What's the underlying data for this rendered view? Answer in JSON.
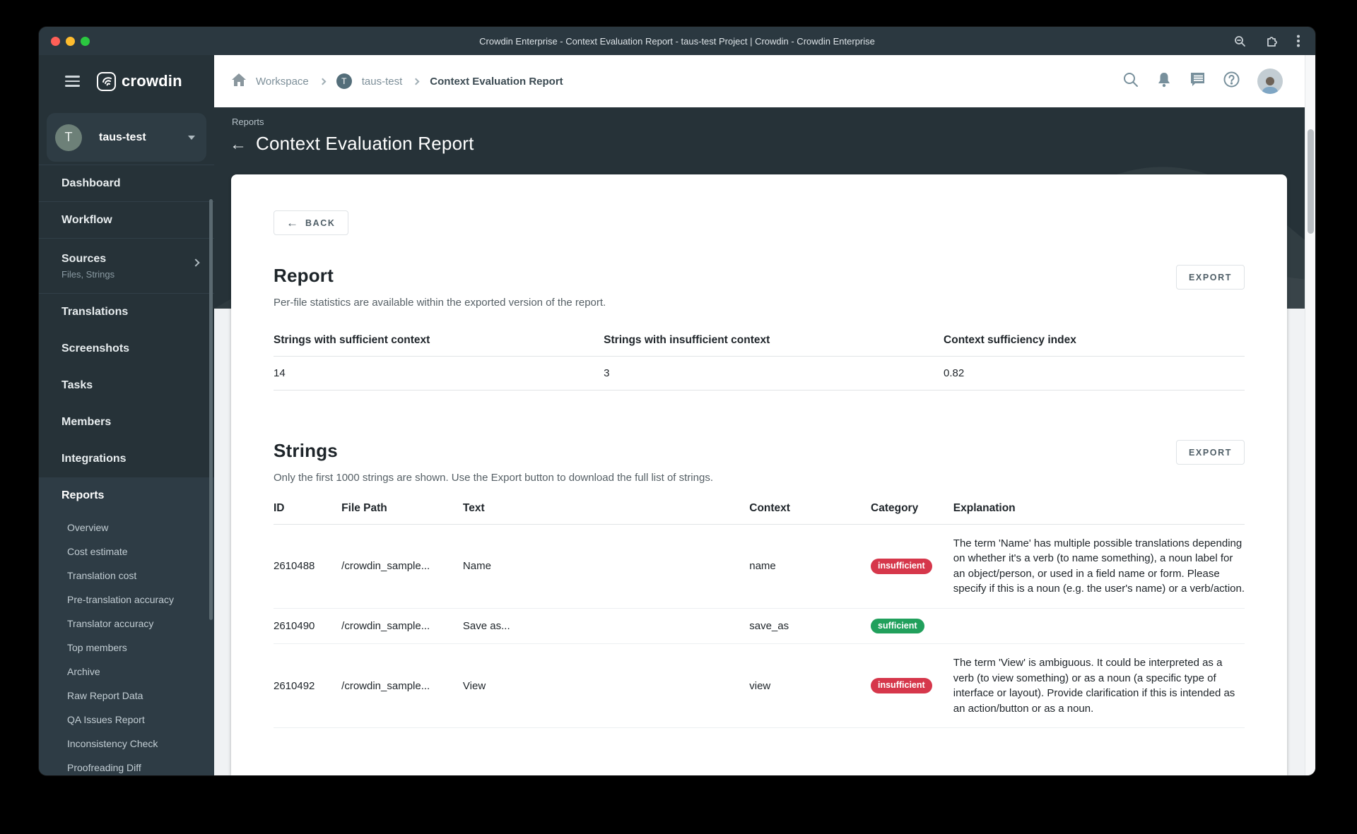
{
  "window": {
    "title": "Crowdin Enterprise - Context Evaluation Report - taus-test Project | Crowdin - Crowdin Enterprise",
    "traffic_lights": {
      "close": "#ff5f57",
      "minimize": "#febc2e",
      "zoom": "#2bc840"
    }
  },
  "brand": {
    "name": "crowdin"
  },
  "breadcrumb": {
    "workspace": "Workspace",
    "project_initial": "T",
    "project": "taus-test",
    "page": "Context Evaluation Report"
  },
  "sidebar": {
    "project": {
      "initial": "T",
      "name": "taus-test"
    },
    "items": [
      {
        "label": "Dashboard"
      },
      {
        "label": "Workflow"
      },
      {
        "label": "Sources",
        "sub": "Files, Strings"
      },
      {
        "label": "Translations"
      },
      {
        "label": "Screenshots"
      },
      {
        "label": "Tasks"
      },
      {
        "label": "Members"
      },
      {
        "label": "Integrations"
      },
      {
        "label": "Reports"
      }
    ],
    "reports_subitems": [
      "Overview",
      "Cost estimate",
      "Translation cost",
      "Pre-translation accuracy",
      "Translator accuracy",
      "Top members",
      "Archive",
      "Raw Report Data",
      "QA Issues Report",
      "Inconsistency Check",
      "Proofreading Diff"
    ]
  },
  "hero": {
    "eyebrow": "Reports",
    "back_arrow": "←",
    "title": "Context Evaluation Report"
  },
  "report": {
    "back_label": "BACK",
    "back_arrow": "←",
    "heading": "Report",
    "subtitle": "Per-file statistics are available within the exported version of the report.",
    "export_label": "EXPORT",
    "stats": [
      {
        "label": "Strings with sufficient context",
        "value": "14"
      },
      {
        "label": "Strings with insufficient context",
        "value": "3"
      },
      {
        "label": "Context sufficiency index",
        "value": "0.82"
      }
    ]
  },
  "strings": {
    "heading": "Strings",
    "subtitle": "Only the first 1000 strings are shown. Use the Export button to download the full list of strings.",
    "export_label": "EXPORT",
    "columns": [
      "ID",
      "File Path",
      "Text",
      "Context",
      "Category",
      "Explanation"
    ],
    "colors": {
      "insufficient": "#d6374b",
      "sufficient": "#21a05c"
    },
    "rows": [
      {
        "id": "2610488",
        "file_path": "/crowdin_sample...",
        "text": "Name",
        "context": "name",
        "category": "insufficient",
        "explanation": "The term 'Name' has multiple possible translations depending on whether it's a verb (to name something), a noun label for an object/person, or used in a field name or form. Please specify if this is a noun (e.g. the user's name) or a verb/action."
      },
      {
        "id": "2610490",
        "file_path": "/crowdin_sample...",
        "text": "Save as...",
        "context": "save_as",
        "category": "sufficient",
        "explanation": ""
      },
      {
        "id": "2610492",
        "file_path": "/crowdin_sample...",
        "text": "View",
        "context": "view",
        "category": "insufficient",
        "explanation": "The term 'View' is ambiguous. It could be interpreted as a verb (to view something) or as a noun (a specific type of interface or layout). Provide clarification if this is intended as an action/button or as a noun."
      }
    ]
  }
}
